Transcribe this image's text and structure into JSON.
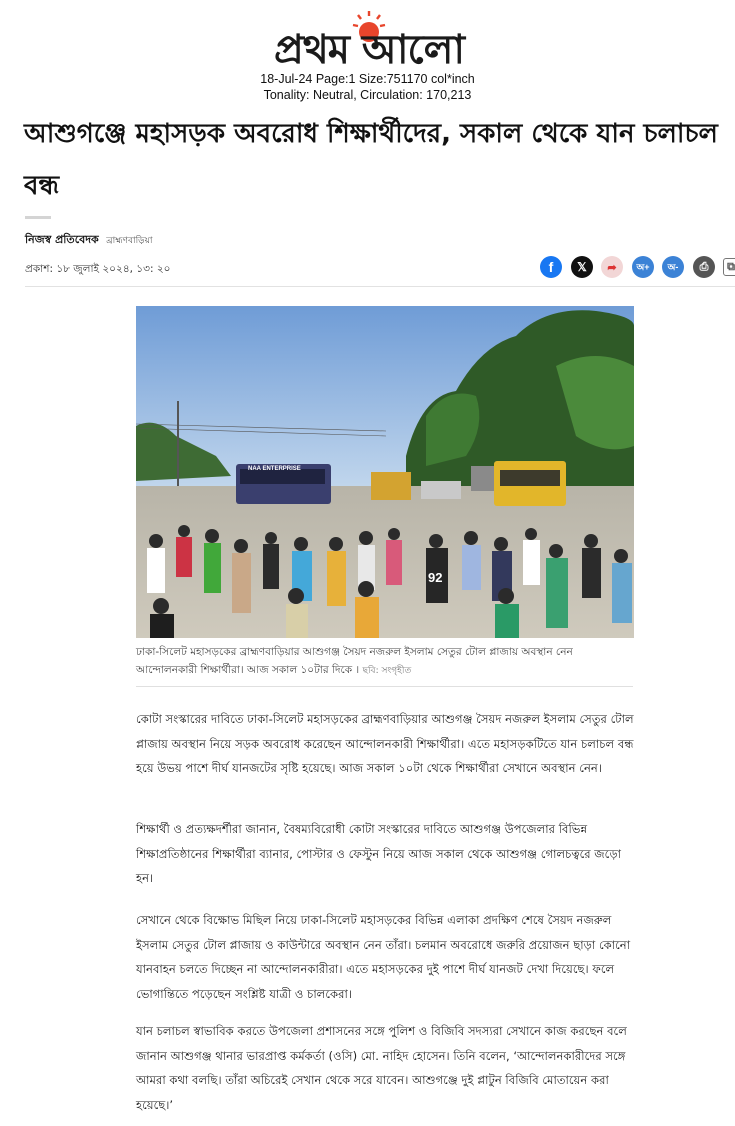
{
  "masthead": {
    "logo_text": "প্রথম আলো",
    "meta_line1": "18-Jul-24 Page:1 Size:751170 col*inch",
    "meta_line2": "Tonality: Neutral, Circulation: 170,213"
  },
  "article": {
    "headline": "আশুগঞ্জে মহাসড়ক অবরোধ শিক্ষার্থীদের, সকাল থেকে যান চলাচল বন্ধ",
    "author": "নিজস্ব প্রতিবেদক",
    "location": "ব্রাহ্মণবাড়িয়া",
    "published": "প্রকাশ: ১৮ জুলাই ২০২৪, ১৩: ২০",
    "photo_caption": "ঢাকা-সিলেট মহাসড়কের ব্রাহ্মণবাড়িয়ার আশুগঞ্জ সৈয়দ নজরুল ইসলাম সেতুর টোল প্লাজায় অবস্থান নেন আন্দোলনকারী শিক্ষার্থীরা। আজ সকাল ১০টার দিকে ।",
    "photo_credit": "ছবি: সংগৃহীত",
    "photo_signs": [
      "NAA ENTERPRISE",
      "92"
    ],
    "paragraphs": [
      "কোটা সংস্কারের দাবিতে ঢাকা-সিলেট মহাসড়কের ব্রাহ্মণবাড়িয়ার আশুগঞ্জ সৈয়দ নজরুল ইসলাম সেতুর টোল প্লাজায় অবস্থান নিয়ে সড়ক অবরোধ করেছেন আন্দোলনকারী শিক্ষার্থীরা। এতে মহাসড়কটিতে যান চলাচল বন্ধ হয়ে উভয় পাশে দীর্ঘ যানজটের সৃষ্টি হয়েছে। আজ সকাল ১০টা থেকে শিক্ষার্থীরা সেখানে অবস্থান নেন।",
      "শিক্ষার্থী ও প্রত্যক্ষদর্শীরা জানান, বৈষম্যবিরোধী কোটা সংস্কারের দাবিতে আশুগঞ্জ উপজেলার বিভিন্ন শিক্ষাপ্রতিষ্ঠানের শিক্ষার্থীরা ব্যানার, পোস্টার ও ফেস্টুন নিয়ে আজ সকাল থেকে আশুগঞ্জ গোলচত্বরে জড়ো হন।",
      "সেখানে থেকে বিক্ষোভ মিছিল নিয়ে ঢাকা-সিলেট মহাসড়কের বিভিন্ন এলাকা প্রদক্ষিণ শেষে সৈয়দ নজরুল ইসলাম সেতুর টোল প্লাজায় ও কাউন্টারে অবস্থান নেন তাঁরা। চলমান অবরোধে জরুরি প্রয়োজন ছাড়া কোনো যানবাহন চলতে দিচ্ছেন না আন্দোলনকারীরা। এতে মহাসড়কের দুই পাশে দীর্ঘ যানজট দেখা দিয়েছে। ফলে ভোগান্তিতে পড়েছেন সংশ্লিষ্ট যাত্রী ও চালকেরা।",
      "যান চলাচল স্বাভাবিক করতে উপজেলা প্রশাসনের সঙ্গে পুলিশ ও বিজিবি সদস্যরা সেখানে কাজ করছেন বলে জানান আশুগঞ্জ থানার ভারপ্রাপ্ত কর্মকর্তা (ওসি) মো. নাহিদ হোসেন। তিনি বলেন, ‘আন্দোলনকারীদের সঙ্গে আমরা কথা বলছি। তাঁরা অচিরেই সেখান থেকে সরে যাবেন। আশুগঞ্জে দুই প্লাটুন বিজিবি মোতায়েন করা হয়েছে।’"
    ]
  },
  "share": {
    "buttons": [
      {
        "name": "facebook",
        "glyph": "f"
      },
      {
        "name": "x",
        "glyph": "𝕏"
      },
      {
        "name": "share",
        "glyph": "➦"
      },
      {
        "name": "font-increase",
        "glyph": "অ+"
      },
      {
        "name": "font-decrease",
        "glyph": "অ-"
      },
      {
        "name": "print",
        "glyph": "⎙"
      },
      {
        "name": "copy",
        "glyph": "⧉"
      }
    ]
  },
  "colors": {
    "logo_sun": "#e8452c",
    "facebook": "#1877f2",
    "font_buttons": "#3b82d6",
    "bus_yellow": "#e2b62a"
  }
}
